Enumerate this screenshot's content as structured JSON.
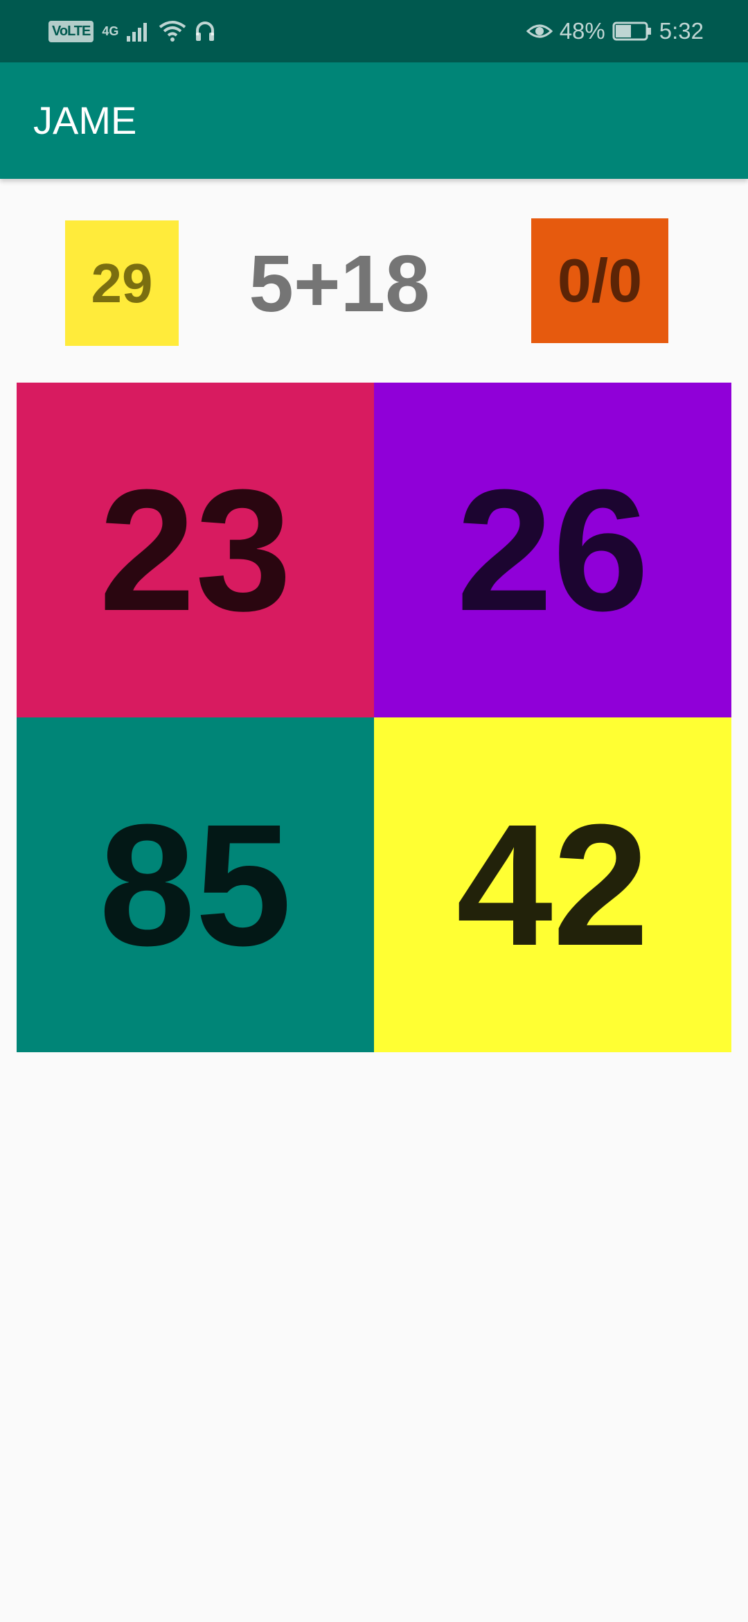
{
  "status_bar": {
    "volte": "VoLTE",
    "network": "4G",
    "battery_percent": "48%",
    "time": "5:32",
    "icons": [
      "signal-icon",
      "wifi-icon",
      "headphones-icon",
      "eye-icon",
      "battery-icon"
    ]
  },
  "app_bar": {
    "title": "JAME"
  },
  "game": {
    "target": "29",
    "equation": "5+18",
    "score": "0/0",
    "options": [
      {
        "value": "23",
        "color": "#d81b60"
      },
      {
        "value": "26",
        "color": "#9000d8"
      },
      {
        "value": "85",
        "color": "#008577"
      },
      {
        "value": "42",
        "color": "#ffff33"
      }
    ]
  },
  "colors": {
    "status_bar": "#00594f",
    "app_bar": "#008577",
    "target_box": "#ffeb3b",
    "score_box": "#e65a0e",
    "background": "#fafafa"
  }
}
